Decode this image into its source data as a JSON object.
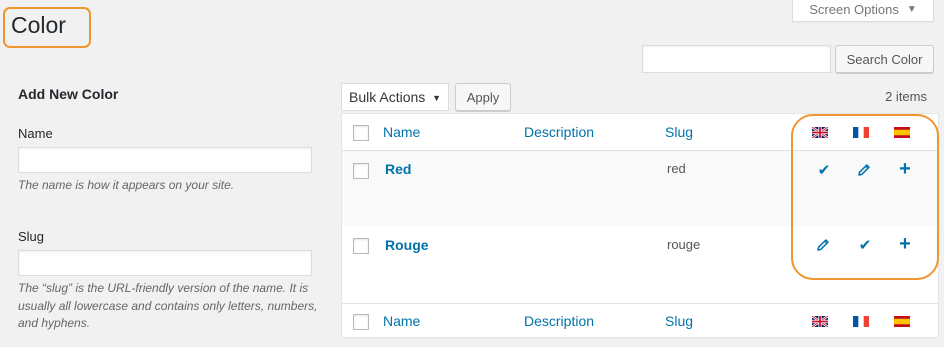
{
  "header": {
    "title": "Color",
    "screen_options": "Screen Options"
  },
  "search": {
    "value": "",
    "placeholder": "",
    "button": "Search Color"
  },
  "form": {
    "title": "Add New Color",
    "name_label": "Name",
    "name_value": "",
    "name_help": "The name is how it appears on your site.",
    "slug_label": "Slug",
    "slug_value": "",
    "slug_help": "The “slug” is the URL-friendly version of the name. It is usually all lowercase and contains only letters, numbers, and hyphens."
  },
  "toolbar": {
    "bulk_actions": "Bulk Actions",
    "apply": "Apply",
    "items_count": "2 items"
  },
  "table": {
    "columns": [
      "Name",
      "Description",
      "Slug"
    ],
    "languages": [
      "en",
      "fr",
      "es"
    ],
    "rows": [
      {
        "name": "Red",
        "description": "",
        "slug": "red",
        "lang_status": [
          "check-icon",
          "pencil-icon",
          "plus-icon"
        ]
      },
      {
        "name": "Rouge",
        "description": "",
        "slug": "rouge",
        "lang_status": [
          "pencil-icon",
          "check-icon",
          "plus-icon"
        ]
      }
    ]
  },
  "colors": {
    "link": "#0073aa",
    "highlight": "#f0962e",
    "background": "#f1f1f1"
  }
}
